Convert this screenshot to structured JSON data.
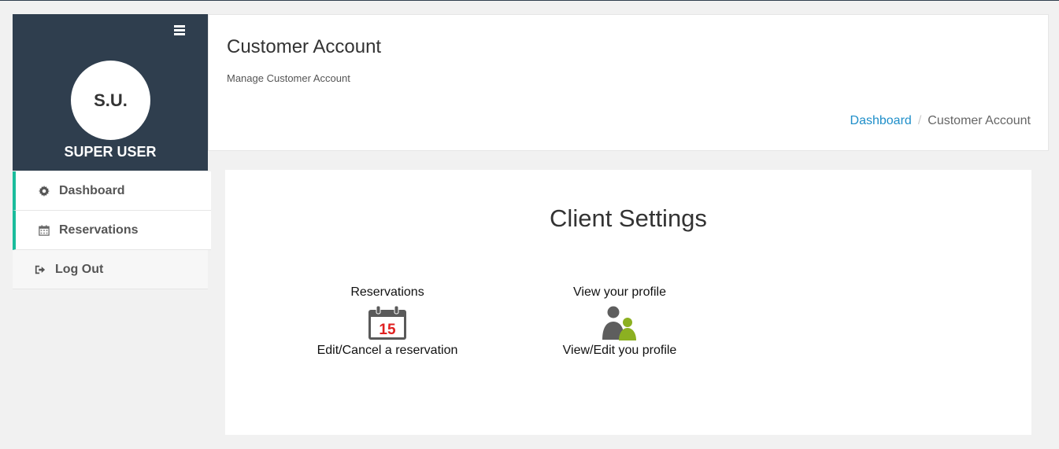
{
  "sidebar": {
    "avatar_initials": "S.U.",
    "user_name": "SUPER USER",
    "menu": [
      {
        "label": "Dashboard",
        "icon": "gear-icon"
      },
      {
        "label": "Reservations",
        "icon": "calendar-icon"
      },
      {
        "label": "Log Out",
        "icon": "sign-out-icon"
      }
    ]
  },
  "header": {
    "title": "Customer Account",
    "subtitle": "Manage Customer Account",
    "breadcrumb": {
      "home": "Dashboard",
      "separator": "/",
      "current": "Customer Account"
    }
  },
  "main": {
    "title": "Client Settings",
    "tiles": [
      {
        "heading": "Reservations",
        "icon": "calendar-15-icon",
        "icon_text": "15",
        "description": "Edit/Cancel a reservation"
      },
      {
        "heading": "View your profile",
        "icon": "users-icon",
        "description": "View/Edit you profile"
      }
    ]
  },
  "colors": {
    "sidebar_bg": "#2f3e4e",
    "accent": "#1abc9c",
    "link": "#1e8ec9",
    "calendar_red": "#e02020",
    "profile_green": "#8cb021",
    "profile_gray": "#5e5e5e"
  }
}
